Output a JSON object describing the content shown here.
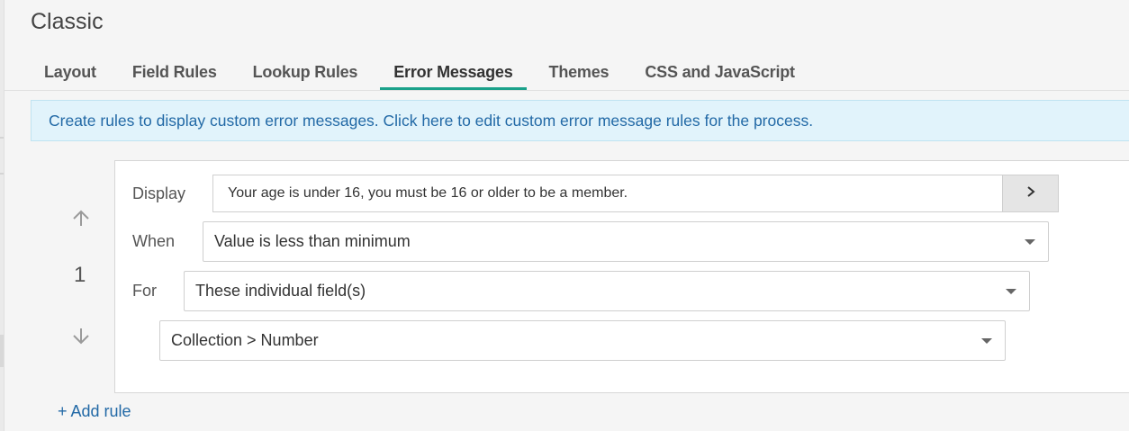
{
  "page": {
    "title": "Classic"
  },
  "tabs": [
    {
      "label": "Layout"
    },
    {
      "label": "Field Rules"
    },
    {
      "label": "Lookup Rules"
    },
    {
      "label": "Error Messages",
      "active": true
    },
    {
      "label": "Themes"
    },
    {
      "label": "CSS and JavaScript"
    }
  ],
  "banner": {
    "text_before": "Create rules to display custom error messages. Click ",
    "link": "here",
    "text_after": " to edit custom error message rules for the process."
  },
  "rule": {
    "number": "1",
    "display_label": "Display",
    "display_value": "Your age is under 16, you must be 16 or older to be a member.",
    "when_label": "When",
    "when_value": "Value is less than minimum",
    "for_label": "For",
    "for_value": "These individual field(s)",
    "field_value": "Collection > Number"
  },
  "actions": {
    "add_rule": "+ Add rule"
  },
  "icons": {
    "move_up": "arrow-up-icon",
    "move_down": "arrow-down-icon",
    "expand": "chevron-right-icon",
    "dropdown": "caret-down-icon"
  },
  "colors": {
    "accent": "#1aa18a",
    "link": "#2269a6",
    "banner_bg": "#e1f3fb"
  }
}
